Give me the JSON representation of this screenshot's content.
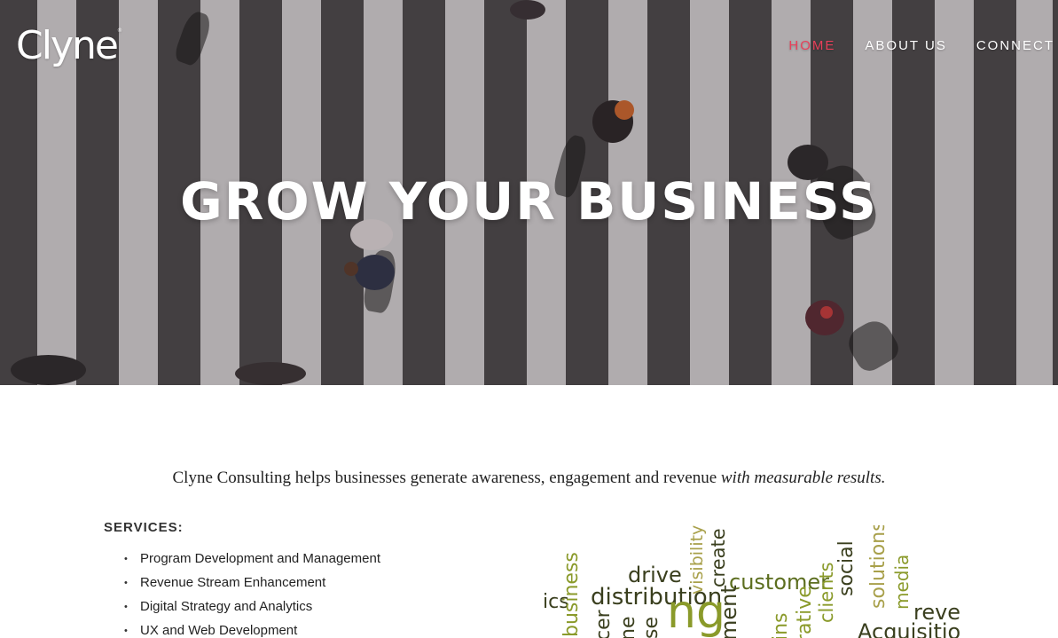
{
  "brand": {
    "logo_text": "Clyne"
  },
  "nav": {
    "items": [
      {
        "label": "HOME",
        "active": true
      },
      {
        "label": "ABOUT US",
        "active": false
      },
      {
        "label": "CONNECT",
        "active": false
      }
    ],
    "active_color": "#e8405a"
  },
  "hero": {
    "title": "GROW YOUR BUSINESS"
  },
  "intro": {
    "text": "Clyne Consulting helps businesses generate awareness, engagement and revenue ",
    "emphasis": "with measurable results."
  },
  "services": {
    "heading": "SERVICES:",
    "items": [
      "Program Development and Management",
      "Revenue Stream Enhancement",
      "Digital Strategy and Analytics",
      "UX and Web Development"
    ]
  },
  "wordcloud": {
    "words": [
      "business",
      "drive",
      "visibility",
      "create",
      "customer",
      "distribution",
      "social",
      "clients",
      "solutions",
      "media",
      "reve",
      "Acquisition",
      "ment",
      "rative",
      "ng",
      "ics",
      "se",
      "cer",
      "ne",
      "ins"
    ],
    "colors": {
      "olive": "#8a9a2a",
      "dark": "#3a3f1e",
      "green": "#5c6e1f",
      "khaki": "#a8a04a"
    }
  }
}
